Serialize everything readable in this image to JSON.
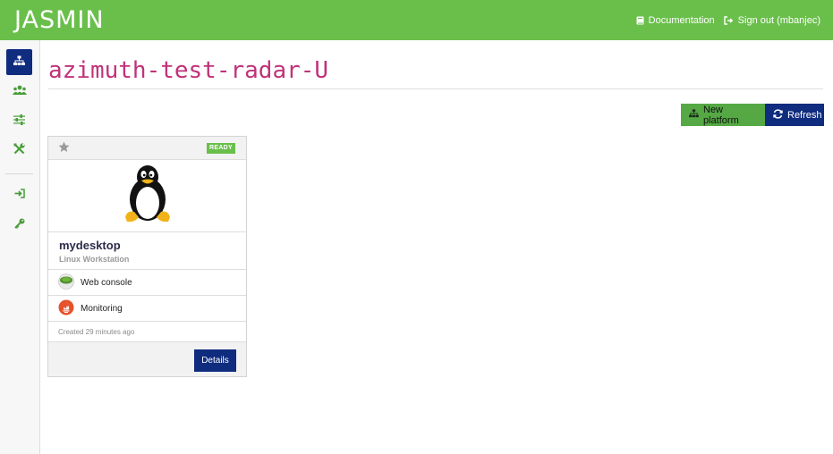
{
  "header": {
    "brand": "JASMIN",
    "documentation_label": "Documentation",
    "signout_label": "Sign out (mbanjec)",
    "bg_color": "#6abf4b"
  },
  "sidebar": {
    "items": [
      {
        "icon": "sitemap-icon",
        "active": true
      },
      {
        "icon": "users-icon",
        "active": false
      },
      {
        "icon": "sliders-icon",
        "active": false
      },
      {
        "icon": "tools-icon",
        "active": false
      },
      {
        "icon": "sign-in-icon",
        "active": false
      },
      {
        "icon": "key-icon",
        "active": false
      }
    ]
  },
  "page": {
    "title": "azimuth-test-radar-U"
  },
  "actions": {
    "new_platform_label": "New platform",
    "refresh_label": "Refresh"
  },
  "platform_card": {
    "status": "READY",
    "name": "mydesktop",
    "type": "Linux Workstation",
    "services": [
      {
        "label": "Web console",
        "icon": "guacamole-icon"
      },
      {
        "label": "Monitoring",
        "icon": "prometheus-icon"
      }
    ],
    "created": "Created 29 minutes ago",
    "details_label": "Details"
  }
}
